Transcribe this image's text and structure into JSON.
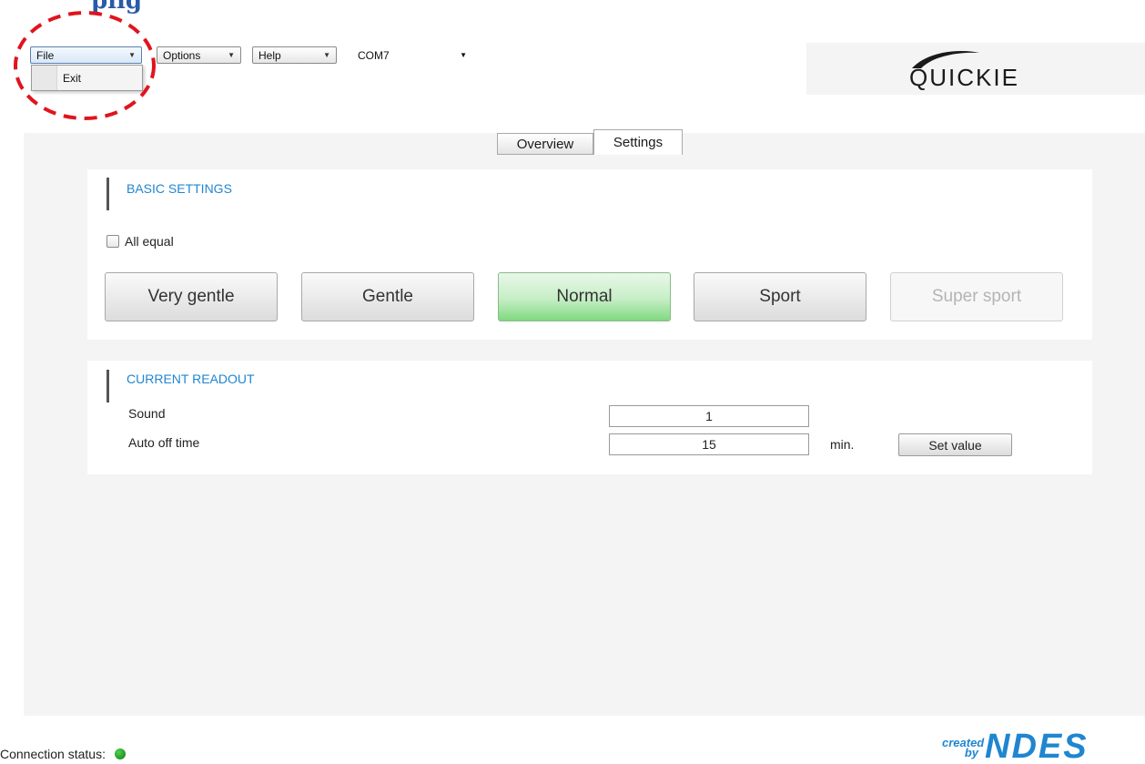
{
  "top_fragment": "plig",
  "menubar": {
    "file": "File",
    "options": "Options",
    "help": "Help",
    "port": "COM7"
  },
  "file_menu": {
    "items": [
      "Exit"
    ]
  },
  "logo": "QUICKIE",
  "tabs": [
    "Overview",
    "Settings"
  ],
  "active_tab": "Settings",
  "basic_settings": {
    "title": "BASIC SETTINGS",
    "all_equal_label": "All equal",
    "all_equal_checked": false,
    "modes": [
      "Very gentle",
      "Gentle",
      "Normal",
      "Sport",
      "Super sport"
    ],
    "selected_mode": "Normal",
    "disabled_mode": "Super sport"
  },
  "current_readout": {
    "title": "CURRENT READOUT",
    "sound_label": "Sound",
    "sound_value": "1",
    "auto_off_label": "Auto off time",
    "auto_off_value": "15",
    "auto_off_unit": "min.",
    "set_button": "Set value"
  },
  "footer": {
    "connection_label": "Connection status:",
    "connection_color": "#1a9a1a",
    "created_by": "created by",
    "brand": "NDES"
  },
  "colors": {
    "accent": "#1f86d0",
    "annotation": "#e0141e"
  }
}
